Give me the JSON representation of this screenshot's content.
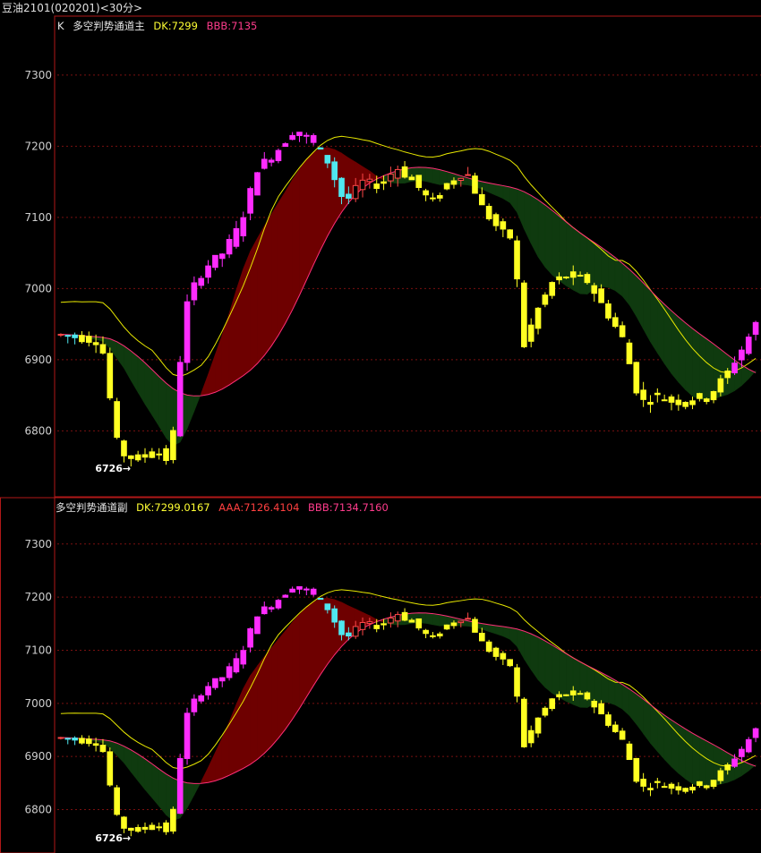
{
  "window": {
    "title": "豆油2101(020201)<30分>"
  },
  "colors": {
    "up": "#ff4848",
    "down": "#4fe8f0",
    "magenta": "#ff2cff",
    "yellow": "#ffff22",
    "dk_line": "#e8e800",
    "lower_line": "#ff2e78",
    "band_red": "#6e0000",
    "band_green": "#0f3a0f",
    "grid": "#7a1010",
    "frame": "#b01818"
  },
  "main_panel": {
    "header": {
      "prefix": "K",
      "name": "多空判势通道主",
      "dk": "DK:7299",
      "bbb": "BBB:7135"
    },
    "y_ticks": [
      "7300",
      "7200",
      "7100",
      "7000",
      "6900",
      "6800"
    ],
    "low_label": "6726"
  },
  "sub_panel": {
    "header": {
      "name": "多空判势通道副",
      "dk": "DK:7299.0167",
      "aaa": "AAA:7126.4104",
      "bbb": "BBB:7134.7160"
    },
    "y_ticks": [
      "7300",
      "7200",
      "7100",
      "7000",
      "6900",
      "6800"
    ],
    "low_label": "6726"
  }
}
